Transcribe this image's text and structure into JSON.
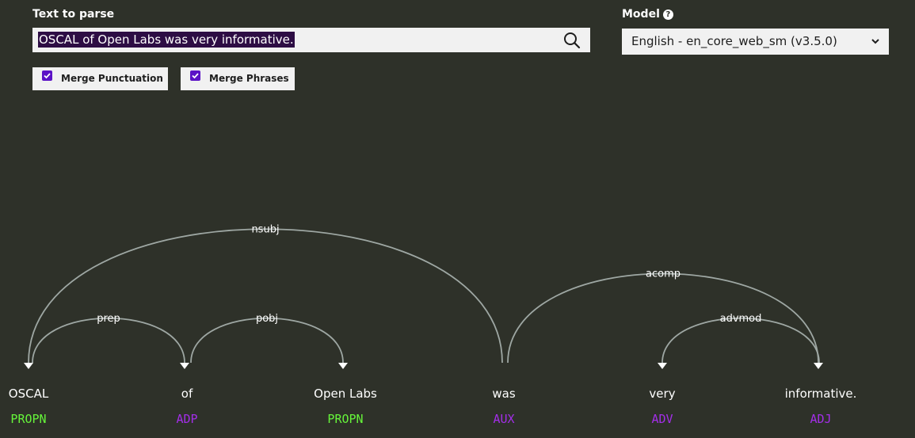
{
  "form": {
    "text_label": "Text to parse",
    "text_value": "OSCAL of Open Labs was very informative.",
    "model_label": "Model",
    "model_value": "English - en_core_web_sm (v3.5.0)",
    "merge_punct_label": "Merge Punctuation",
    "merge_phrases_label": "Merge Phrases",
    "merge_punct_checked": true,
    "merge_phrases_checked": true
  },
  "parse": {
    "words": [
      {
        "text": "OSCAL",
        "tag": "PROPN"
      },
      {
        "text": "of",
        "tag": "ADP"
      },
      {
        "text": "Open Labs",
        "tag": "PROPN"
      },
      {
        "text": "was",
        "tag": "AUX"
      },
      {
        "text": "very",
        "tag": "ADV"
      },
      {
        "text": "informative.",
        "tag": "ADJ"
      }
    ],
    "arcs": [
      {
        "label": "prep",
        "head": 0,
        "dep": 1
      },
      {
        "label": "pobj",
        "head": 1,
        "dep": 2
      },
      {
        "label": "nsubj",
        "head": 3,
        "dep": 0
      },
      {
        "label": "advmod",
        "head": 5,
        "dep": 4
      },
      {
        "label": "acomp",
        "head": 3,
        "dep": 5
      }
    ],
    "colors": {
      "PROPN": "#66f53a",
      "ADP": "#a32ee8",
      "AUX": "#a32ee8",
      "ADV": "#a32ee8",
      "ADJ": "#a32ee8",
      "arc": "#9ea7a3"
    }
  }
}
